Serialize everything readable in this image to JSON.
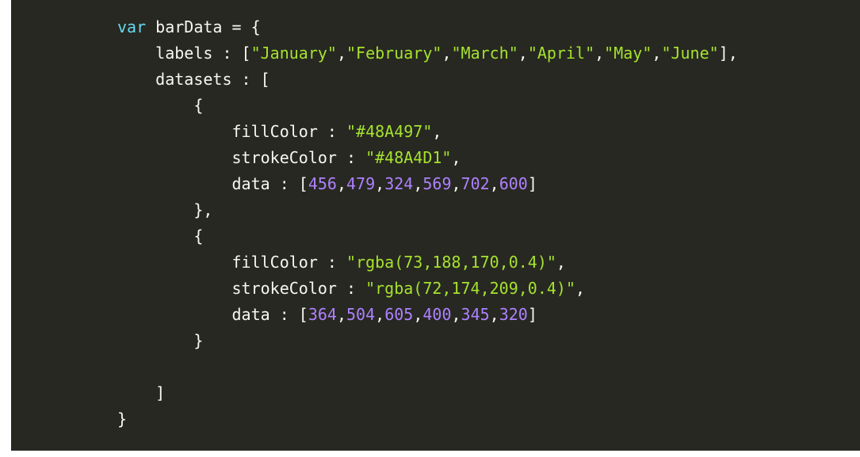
{
  "code": {
    "keyword_var": "var",
    "var_name": "barData",
    "open_object": "= {",
    "labels_key": "labels",
    "labels_values": [
      "\"January\"",
      "\"February\"",
      "\"March\"",
      "\"April\"",
      "\"May\"",
      "\"June\""
    ],
    "datasets_key": "datasets",
    "dataset1": {
      "fillColor_key": "fillColor",
      "fillColor_value": "\"#48A497\"",
      "strokeColor_key": "strokeColor",
      "strokeColor_value": "\"#48A4D1\"",
      "data_key": "data",
      "data_values": [
        "456",
        "479",
        "324",
        "569",
        "702",
        "600"
      ]
    },
    "dataset2": {
      "fillColor_key": "fillColor",
      "fillColor_value": "\"rgba(73,188,170,0.4)\"",
      "strokeColor_key": "strokeColor",
      "strokeColor_value": "\"rgba(72,174,209,0.4)\"",
      "data_key": "data",
      "data_values": [
        "364",
        "504",
        "605",
        "400",
        "345",
        "320"
      ]
    }
  },
  "colors": {
    "background": "#272822",
    "keyword": "#66d9ef",
    "string": "#a6e22e",
    "number": "#ae81ff",
    "text": "#f8f8f2"
  }
}
